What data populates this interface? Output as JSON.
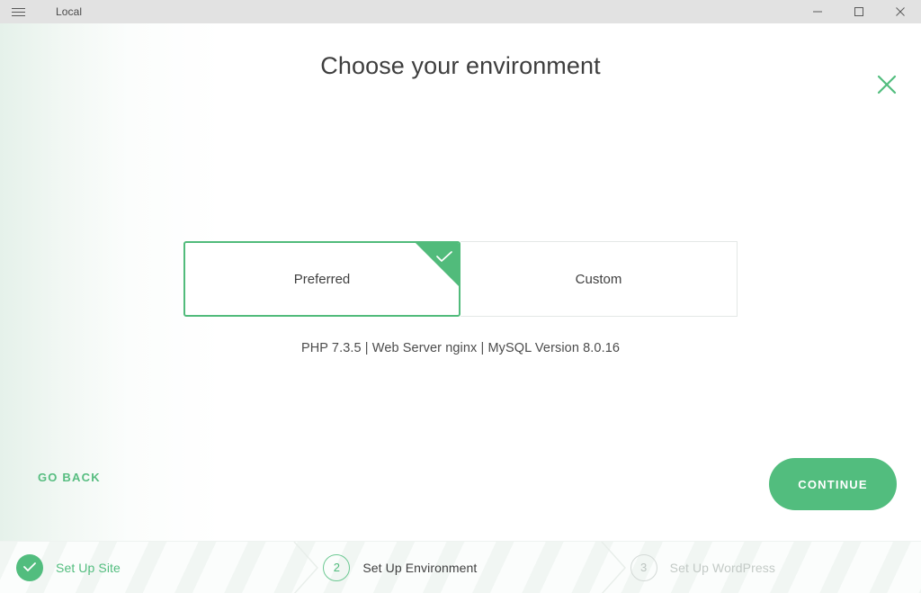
{
  "titlebar": {
    "menu_icon": "hamburger-icon",
    "title": "Local",
    "minimize_label": "Minimize",
    "maximize_label": "Maximize",
    "close_label": "Close"
  },
  "header": {
    "title": "Choose your environment",
    "close_icon": "close-x-icon",
    "accent_color": "#52bd7e"
  },
  "environment": {
    "options": [
      {
        "label": "Preferred",
        "selected": true
      },
      {
        "label": "Custom",
        "selected": false
      }
    ],
    "summary": "PHP 7.3.5 | Web Server nginx | MySQL Version 8.0.16",
    "check_icon": "check-icon"
  },
  "actions": {
    "back_label": "GO BACK",
    "continue_label": "CONTINUE"
  },
  "steps": [
    {
      "marker": "✓",
      "label": "Set Up Site",
      "state": "done"
    },
    {
      "marker": "2",
      "label": "Set Up Environment",
      "state": "active"
    },
    {
      "marker": "3",
      "label": "Set Up WordPress",
      "state": "todo"
    }
  ]
}
